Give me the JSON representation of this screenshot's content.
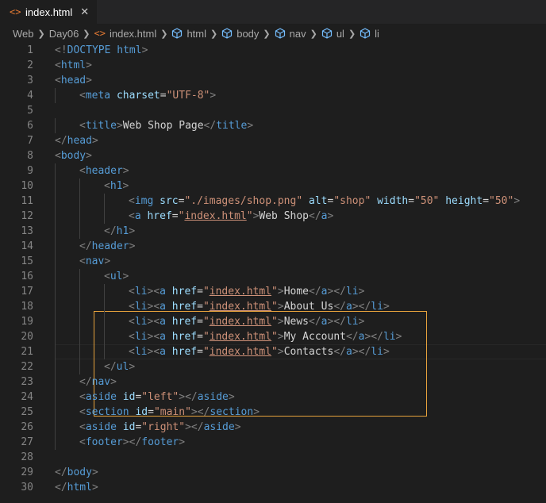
{
  "tab": {
    "icon": "<>",
    "filename": "index.html",
    "close": "✕"
  },
  "breadcrumb": [
    "Web",
    "Day06",
    "index.html",
    "html",
    "body",
    "nav",
    "ul",
    "li"
  ],
  "lines": [
    {
      "n": "1",
      "i": 0,
      "t": [
        [
          "t",
          "<!"
        ],
        [
          "dt",
          "DOCTYPE "
        ],
        [
          "tn",
          "html"
        ],
        [
          "t",
          ">"
        ]
      ]
    },
    {
      "n": "2",
      "i": 0,
      "t": [
        [
          "t",
          "<"
        ],
        [
          "tn",
          "html"
        ],
        [
          "t",
          ">"
        ]
      ]
    },
    {
      "n": "3",
      "i": 0,
      "t": [
        [
          "t",
          "<"
        ],
        [
          "tn",
          "head"
        ],
        [
          "t",
          ">"
        ]
      ]
    },
    {
      "n": "4",
      "i": 1,
      "t": [
        [
          "t",
          "<"
        ],
        [
          "tn",
          "meta"
        ],
        [
          "tx",
          " "
        ],
        [
          "an",
          "charset"
        ],
        [
          "tx",
          "="
        ],
        [
          "av",
          "\"UTF-8\""
        ],
        [
          "t",
          ">"
        ]
      ]
    },
    {
      "n": "5",
      "i": 0,
      "t": []
    },
    {
      "n": "6",
      "i": 1,
      "t": [
        [
          "t",
          "<"
        ],
        [
          "tn",
          "title"
        ],
        [
          "t",
          ">"
        ],
        [
          "tx",
          "Web Shop Page"
        ],
        [
          "t",
          "</"
        ],
        [
          "tn",
          "title"
        ],
        [
          "t",
          ">"
        ]
      ]
    },
    {
      "n": "7",
      "i": 0,
      "t": [
        [
          "t",
          "</"
        ],
        [
          "tn",
          "head"
        ],
        [
          "t",
          ">"
        ]
      ]
    },
    {
      "n": "8",
      "i": 0,
      "t": [
        [
          "t",
          "<"
        ],
        [
          "tn",
          "body"
        ],
        [
          "t",
          ">"
        ]
      ]
    },
    {
      "n": "9",
      "i": 1,
      "t": [
        [
          "t",
          "<"
        ],
        [
          "tn",
          "header"
        ],
        [
          "t",
          ">"
        ]
      ]
    },
    {
      "n": "10",
      "i": 2,
      "t": [
        [
          "t",
          "<"
        ],
        [
          "tn",
          "h1"
        ],
        [
          "t",
          ">"
        ]
      ]
    },
    {
      "n": "11",
      "i": 3,
      "t": [
        [
          "t",
          "<"
        ],
        [
          "tn",
          "img"
        ],
        [
          "tx",
          " "
        ],
        [
          "an",
          "src"
        ],
        [
          "tx",
          "="
        ],
        [
          "av",
          "\"./images/shop.png\""
        ],
        [
          "tx",
          " "
        ],
        [
          "an",
          "alt"
        ],
        [
          "tx",
          "="
        ],
        [
          "av",
          "\"shop\""
        ],
        [
          "tx",
          " "
        ],
        [
          "an",
          "width"
        ],
        [
          "tx",
          "="
        ],
        [
          "av",
          "\"50\""
        ],
        [
          "tx",
          " "
        ],
        [
          "an",
          "height"
        ],
        [
          "tx",
          "="
        ],
        [
          "av",
          "\"50\""
        ],
        [
          "t",
          ">"
        ]
      ]
    },
    {
      "n": "12",
      "i": 3,
      "t": [
        [
          "t",
          "<"
        ],
        [
          "tn",
          "a"
        ],
        [
          "tx",
          " "
        ],
        [
          "an",
          "href"
        ],
        [
          "tx",
          "="
        ],
        [
          "av",
          "\""
        ],
        [
          "avl",
          "index.html"
        ],
        [
          "av",
          "\""
        ],
        [
          "t",
          ">"
        ],
        [
          "tx",
          "Web Shop"
        ],
        [
          "t",
          "</"
        ],
        [
          "tn",
          "a"
        ],
        [
          "t",
          ">"
        ]
      ]
    },
    {
      "n": "13",
      "i": 2,
      "t": [
        [
          "t",
          "</"
        ],
        [
          "tn",
          "h1"
        ],
        [
          "t",
          ">"
        ]
      ]
    },
    {
      "n": "14",
      "i": 1,
      "t": [
        [
          "t",
          "</"
        ],
        [
          "tn",
          "header"
        ],
        [
          "t",
          ">"
        ]
      ]
    },
    {
      "n": "15",
      "i": 1,
      "t": [
        [
          "t",
          "<"
        ],
        [
          "tn",
          "nav"
        ],
        [
          "t",
          ">"
        ]
      ]
    },
    {
      "n": "16",
      "i": 2,
      "t": [
        [
          "t",
          "<"
        ],
        [
          "tn",
          "ul"
        ],
        [
          "t",
          ">"
        ]
      ]
    },
    {
      "n": "17",
      "i": 3,
      "t": [
        [
          "t",
          "<"
        ],
        [
          "tn",
          "li"
        ],
        [
          "t",
          ">"
        ],
        [
          "t",
          "<"
        ],
        [
          "tn",
          "a"
        ],
        [
          "tx",
          " "
        ],
        [
          "an",
          "href"
        ],
        [
          "tx",
          "="
        ],
        [
          "av",
          "\""
        ],
        [
          "avl",
          "index.html"
        ],
        [
          "av",
          "\""
        ],
        [
          "t",
          ">"
        ],
        [
          "tx",
          "Home"
        ],
        [
          "t",
          "</"
        ],
        [
          "tn",
          "a"
        ],
        [
          "t",
          ">"
        ],
        [
          "t",
          "</"
        ],
        [
          "tn",
          "li"
        ],
        [
          "t",
          ">"
        ]
      ]
    },
    {
      "n": "18",
      "i": 3,
      "t": [
        [
          "t",
          "<"
        ],
        [
          "tn",
          "li"
        ],
        [
          "t",
          ">"
        ],
        [
          "t",
          "<"
        ],
        [
          "tn",
          "a"
        ],
        [
          "tx",
          " "
        ],
        [
          "an",
          "href"
        ],
        [
          "tx",
          "="
        ],
        [
          "av",
          "\""
        ],
        [
          "avl",
          "index.html"
        ],
        [
          "av",
          "\""
        ],
        [
          "t",
          ">"
        ],
        [
          "tx",
          "About Us"
        ],
        [
          "t",
          "</"
        ],
        [
          "tn",
          "a"
        ],
        [
          "t",
          ">"
        ],
        [
          "t",
          "</"
        ],
        [
          "tn",
          "li"
        ],
        [
          "t",
          ">"
        ]
      ]
    },
    {
      "n": "19",
      "i": 3,
      "t": [
        [
          "t",
          "<"
        ],
        [
          "tn",
          "li"
        ],
        [
          "t",
          ">"
        ],
        [
          "t",
          "<"
        ],
        [
          "tn",
          "a"
        ],
        [
          "tx",
          " "
        ],
        [
          "an",
          "href"
        ],
        [
          "tx",
          "="
        ],
        [
          "av",
          "\""
        ],
        [
          "avl",
          "index.html"
        ],
        [
          "av",
          "\""
        ],
        [
          "t",
          ">"
        ],
        [
          "tx",
          "News"
        ],
        [
          "t",
          "</"
        ],
        [
          "tn",
          "a"
        ],
        [
          "t",
          ">"
        ],
        [
          "t",
          "</"
        ],
        [
          "tn",
          "li"
        ],
        [
          "t",
          ">"
        ]
      ]
    },
    {
      "n": "20",
      "i": 3,
      "t": [
        [
          "t",
          "<"
        ],
        [
          "tn",
          "li"
        ],
        [
          "t",
          ">"
        ],
        [
          "t",
          "<"
        ],
        [
          "tn",
          "a"
        ],
        [
          "tx",
          " "
        ],
        [
          "an",
          "href"
        ],
        [
          "tx",
          "="
        ],
        [
          "av",
          "\""
        ],
        [
          "avl",
          "index.html"
        ],
        [
          "av",
          "\""
        ],
        [
          "t",
          ">"
        ],
        [
          "tx",
          "My Account"
        ],
        [
          "t",
          "</"
        ],
        [
          "tn",
          "a"
        ],
        [
          "t",
          ">"
        ],
        [
          "t",
          "</"
        ],
        [
          "tn",
          "li"
        ],
        [
          "t",
          ">"
        ]
      ]
    },
    {
      "n": "21",
      "i": 3,
      "t": [
        [
          "t",
          "<"
        ],
        [
          "tn",
          "li"
        ],
        [
          "t",
          ">"
        ],
        [
          "t",
          "<"
        ],
        [
          "tn",
          "a"
        ],
        [
          "tx",
          " "
        ],
        [
          "an",
          "href"
        ],
        [
          "tx",
          "="
        ],
        [
          "av",
          "\""
        ],
        [
          "avl",
          "index.html"
        ],
        [
          "av",
          "\""
        ],
        [
          "t",
          ">"
        ],
        [
          "tx",
          "Contacts"
        ],
        [
          "t",
          "</"
        ],
        [
          "tn",
          "a"
        ],
        [
          "t",
          ">"
        ],
        [
          "t",
          "</"
        ],
        [
          "tn",
          "li"
        ],
        [
          "t",
          ">"
        ]
      ]
    },
    {
      "n": "22",
      "i": 2,
      "t": [
        [
          "t",
          "</"
        ],
        [
          "tn",
          "ul"
        ],
        [
          "t",
          ">"
        ]
      ]
    },
    {
      "n": "23",
      "i": 1,
      "t": [
        [
          "t",
          "</"
        ],
        [
          "tn",
          "nav"
        ],
        [
          "t",
          ">"
        ]
      ]
    },
    {
      "n": "24",
      "i": 1,
      "t": [
        [
          "t",
          "<"
        ],
        [
          "tn",
          "aside"
        ],
        [
          "tx",
          " "
        ],
        [
          "an",
          "id"
        ],
        [
          "tx",
          "="
        ],
        [
          "av",
          "\"left\""
        ],
        [
          "t",
          ">"
        ],
        [
          "t",
          "</"
        ],
        [
          "tn",
          "aside"
        ],
        [
          "t",
          ">"
        ]
      ]
    },
    {
      "n": "25",
      "i": 1,
      "t": [
        [
          "t",
          "<"
        ],
        [
          "tn",
          "section"
        ],
        [
          "tx",
          " "
        ],
        [
          "an",
          "id"
        ],
        [
          "tx",
          "="
        ],
        [
          "av",
          "\"main\""
        ],
        [
          "t",
          ">"
        ],
        [
          "t",
          "</"
        ],
        [
          "tn",
          "section"
        ],
        [
          "t",
          ">"
        ]
      ]
    },
    {
      "n": "26",
      "i": 1,
      "t": [
        [
          "t",
          "<"
        ],
        [
          "tn",
          "aside"
        ],
        [
          "tx",
          " "
        ],
        [
          "an",
          "id"
        ],
        [
          "tx",
          "="
        ],
        [
          "av",
          "\"right\""
        ],
        [
          "t",
          ">"
        ],
        [
          "t",
          "</"
        ],
        [
          "tn",
          "aside"
        ],
        [
          "t",
          ">"
        ]
      ]
    },
    {
      "n": "27",
      "i": 1,
      "t": [
        [
          "t",
          "<"
        ],
        [
          "tn",
          "footer"
        ],
        [
          "t",
          ">"
        ],
        [
          "t",
          "</"
        ],
        [
          "tn",
          "footer"
        ],
        [
          "t",
          ">"
        ]
      ]
    },
    {
      "n": "28",
      "i": 0,
      "t": []
    },
    {
      "n": "29",
      "i": 0,
      "t": [
        [
          "t",
          "</"
        ],
        [
          "tn",
          "body"
        ],
        [
          "t",
          ">"
        ]
      ]
    },
    {
      "n": "30",
      "i": 0,
      "t": [
        [
          "t",
          "</"
        ],
        [
          "tn",
          "html"
        ],
        [
          "t",
          ">"
        ]
      ]
    }
  ],
  "colors": {
    "punctuation": "#808080",
    "tag": "#569cd6",
    "attribute": "#9cdcfe",
    "string": "#ce9178",
    "text": "#d4d4d4",
    "line_number": "#858585",
    "highlight_border": "#e6a23c"
  },
  "highlight_lines": [
    "16",
    "22"
  ]
}
